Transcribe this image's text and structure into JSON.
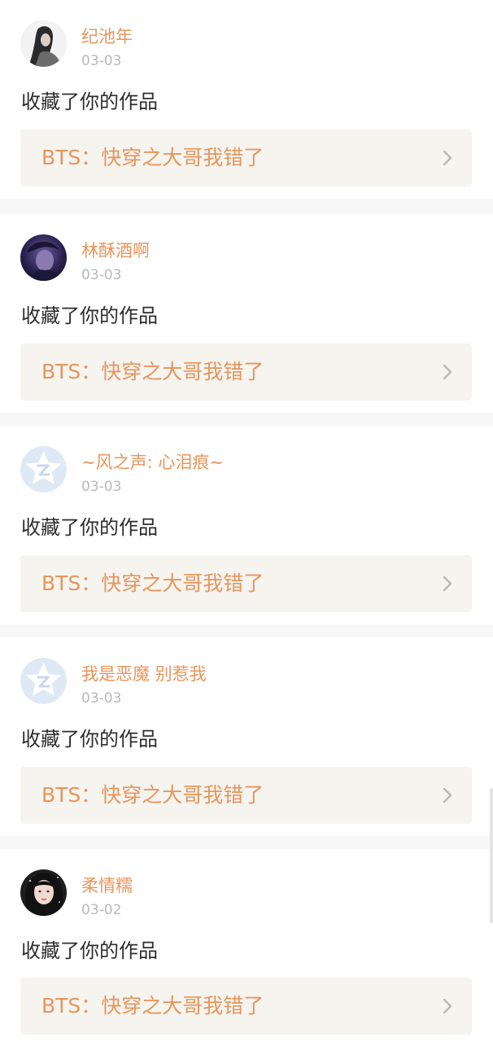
{
  "colors": {
    "accent": "#e8955c",
    "date": "#b9b9b9",
    "text": "#2d2d2d",
    "link_bg": "#f5f4ef",
    "page_bg": "#f7f7f7"
  },
  "notifications": [
    {
      "username": "纪池年",
      "date": "03-03",
      "action": "收藏了你的作品",
      "work_title": "BTS：快穿之大哥我错了",
      "avatar": "photo-girl-dark-hair-icon"
    },
    {
      "username": "林酥酒啊",
      "date": "03-03",
      "action": "收藏了你的作品",
      "work_title": "BTS：快穿之大哥我错了",
      "avatar": "photo-dark-purple-portrait-icon"
    },
    {
      "username": "~风之声: 心泪痕~",
      "date": "03-03",
      "action": "收藏了你的作品",
      "work_title": "BTS：快穿之大哥我错了",
      "avatar": "default-star-avatar-icon"
    },
    {
      "username": "我是恶魔 别惹我",
      "date": "03-03",
      "action": "收藏了你的作品",
      "work_title": "BTS：快穿之大哥我错了",
      "avatar": "default-star-avatar-icon"
    },
    {
      "username": "柔情糯",
      "date": "03-02",
      "action": "收藏了你的作品",
      "work_title": "BTS：快穿之大哥我错了",
      "avatar": "photo-girl-portrait-icon"
    }
  ]
}
